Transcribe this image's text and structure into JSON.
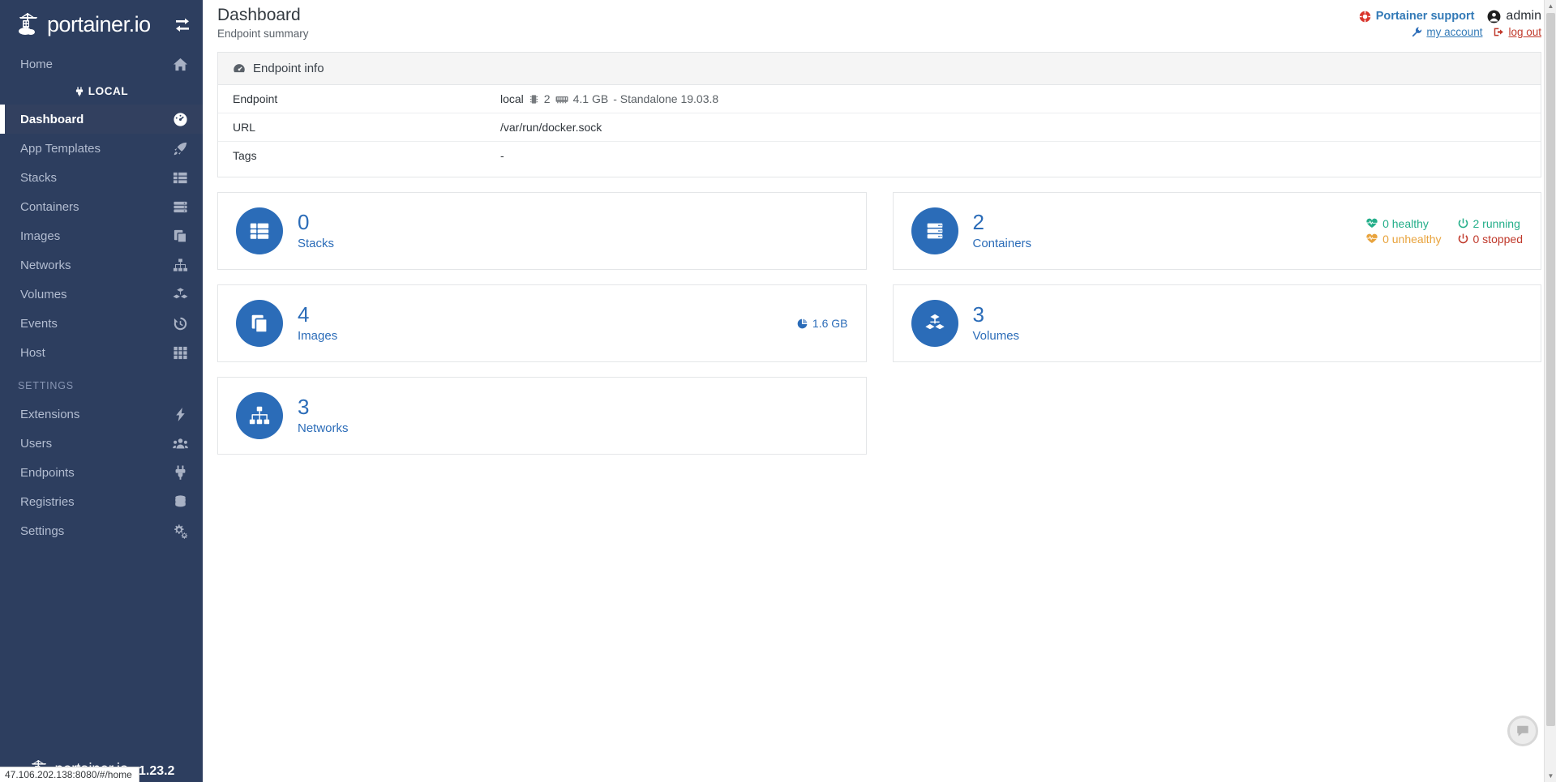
{
  "brand": {
    "name": "portainer.io",
    "toggle_icon": "collapse-expand-icon",
    "logo_icon": "portainer-whale-crane-logo"
  },
  "sidebar": {
    "home": {
      "label": "Home",
      "icon": "home-icon"
    },
    "section_local": {
      "label": "LOCAL",
      "icon": "plug-icon"
    },
    "items": [
      {
        "label": "Dashboard",
        "icon": "dashboard-gauge-icon",
        "active": true
      },
      {
        "label": "App Templates",
        "icon": "rocket-icon",
        "active": false
      },
      {
        "label": "Stacks",
        "icon": "stacks-table-icon",
        "active": false
      },
      {
        "label": "Containers",
        "icon": "containers-server-icon",
        "active": false
      },
      {
        "label": "Images",
        "icon": "images-copy-icon",
        "active": false
      },
      {
        "label": "Networks",
        "icon": "networks-sitemap-icon",
        "active": false
      },
      {
        "label": "Volumes",
        "icon": "volumes-cubes-icon",
        "active": false
      },
      {
        "label": "Events",
        "icon": "events-history-icon",
        "active": false
      },
      {
        "label": "Host",
        "icon": "host-grid-icon",
        "active": false
      }
    ],
    "settings_header": "SETTINGS",
    "settings_items": [
      {
        "label": "Extensions",
        "icon": "bolt-icon"
      },
      {
        "label": "Users",
        "icon": "users-icon"
      },
      {
        "label": "Endpoints",
        "icon": "plug-icon"
      },
      {
        "label": "Registries",
        "icon": "database-icon"
      },
      {
        "label": "Settings",
        "icon": "gears-icon"
      }
    ],
    "footer": {
      "name": "portainer.io",
      "version": "1.23.2",
      "logo_icon": "portainer-logo-small"
    }
  },
  "header": {
    "title": "Dashboard",
    "subtitle": "Endpoint summary",
    "support_label": "Portainer support",
    "support_icon": "life-ring-icon",
    "user_name": "admin",
    "user_icon": "user-circle-icon",
    "my_account_label": "my account",
    "my_account_icon": "wrench-icon",
    "logout_label": "log out",
    "logout_icon": "sign-out-icon"
  },
  "endpoint_info": {
    "panel_title": "Endpoint info",
    "panel_icon": "tachometer-icon",
    "rows": [
      {
        "key": "Endpoint",
        "value": "local",
        "cpu": "2",
        "memory": "4.1 GB",
        "suffix": "- Standalone 19.03.8",
        "cpu_icon": "cpu-microchip-icon",
        "mem_icon": "memory-icon"
      },
      {
        "key": "URL",
        "value": "/var/run/docker.sock"
      },
      {
        "key": "Tags",
        "value": "-"
      }
    ]
  },
  "cards": {
    "left": [
      {
        "count": "0",
        "label": "Stacks",
        "icon": "stacks-table-icon"
      },
      {
        "count": "4",
        "label": "Images",
        "icon": "images-copy-icon",
        "size": "1.6 GB",
        "size_icon": "pie-chart-icon"
      },
      {
        "count": "3",
        "label": "Networks",
        "icon": "networks-sitemap-icon"
      }
    ],
    "right": [
      {
        "count": "2",
        "label": "Containers",
        "icon": "containers-server-icon",
        "stats": [
          {
            "text": "0 healthy",
            "icon": "heartbeat-icon",
            "tone": "green"
          },
          {
            "text": "2 running",
            "icon": "power-icon",
            "tone": "runcolor"
          },
          {
            "text": "0 unhealthy",
            "icon": "heartbeat-icon",
            "tone": "orange"
          },
          {
            "text": "0 stopped",
            "icon": "power-icon",
            "tone": "stopcolor"
          }
        ]
      },
      {
        "count": "3",
        "label": "Volumes",
        "icon": "volumes-cubes-icon"
      }
    ]
  },
  "chat_widget": {
    "icon": "chat-bubble-icon"
  },
  "status_bar": {
    "url": "47.106.202.138:8080/#/home"
  },
  "colors": {
    "sidebar_bg": "#2d3e5f",
    "accent_blue": "#2b6cb8",
    "link_blue": "#337ab7",
    "danger_red": "#c0392b",
    "healthy_green": "#23ae89",
    "warn_orange": "#e8a33d"
  }
}
